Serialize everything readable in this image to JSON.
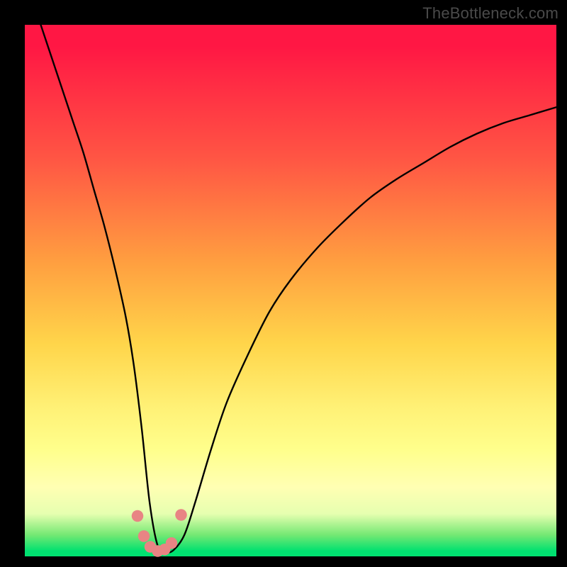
{
  "watermark": "TheBottleneck.com",
  "chart_data": {
    "type": "line",
    "title": "",
    "xlabel": "",
    "ylabel": "",
    "xlim": [
      0,
      100
    ],
    "ylim": [
      0,
      100
    ],
    "grid": false,
    "legend": false,
    "series": [
      {
        "name": "bottleneck-curve",
        "color": "#000000",
        "x": [
          3,
          5,
          7,
          9,
          11,
          13,
          15,
          17,
          19,
          20.5,
          22,
          23.5,
          25,
          26.5,
          28,
          30,
          32,
          35,
          38,
          42,
          46,
          50,
          55,
          60,
          65,
          70,
          75,
          80,
          85,
          90,
          95,
          100
        ],
        "values": [
          100,
          94,
          88,
          82,
          76,
          69,
          62,
          54,
          45,
          36,
          24,
          10,
          2,
          0.8,
          1.2,
          4,
          10,
          20,
          29,
          38,
          46,
          52,
          58,
          63,
          67.5,
          71,
          74,
          77,
          79.5,
          81.5,
          83,
          84.5
        ]
      }
    ],
    "dip_markers": {
      "name": "dip-cluster",
      "color": "#e88484",
      "points": [
        {
          "x": 21.2,
          "y": 7.6
        },
        {
          "x": 22.4,
          "y": 3.8
        },
        {
          "x": 23.6,
          "y": 1.8
        },
        {
          "x": 25.0,
          "y": 1.0
        },
        {
          "x": 26.3,
          "y": 1.3
        },
        {
          "x": 27.6,
          "y": 2.5
        },
        {
          "x": 29.4,
          "y": 7.8
        }
      ],
      "radius_pct": 1.1
    },
    "background_gradient": {
      "top": "#ff1744",
      "mid": "#ffd54a",
      "bottom": "#00e170"
    }
  }
}
